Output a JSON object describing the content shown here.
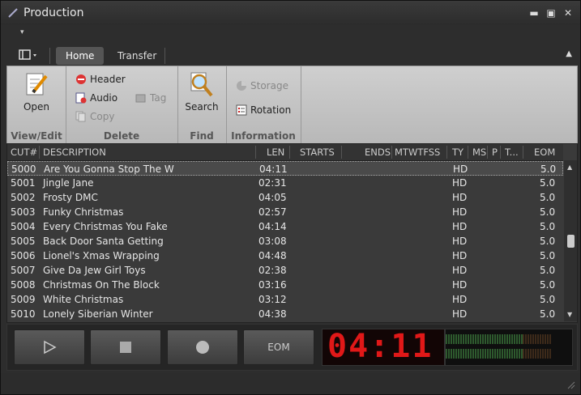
{
  "window": {
    "title": "Production"
  },
  "qat": {
    "icon": "dropdown-arrow"
  },
  "tabs": [
    {
      "label": "Home",
      "active": true
    },
    {
      "label": "Transfer",
      "active": false
    }
  ],
  "ribbon": {
    "view_edit": {
      "label": "View/Edit",
      "open": "Open"
    },
    "delete": {
      "label": "Delete",
      "header": "Header",
      "audio": "Audio",
      "tag": "Tag",
      "copy": "Copy"
    },
    "find": {
      "label": "Find",
      "search": "Search"
    },
    "information": {
      "label": "Information",
      "storage": "Storage",
      "rotation": "Rotation"
    }
  },
  "table": {
    "columns": [
      "CUT#",
      "DESCRIPTION",
      "LEN",
      "STARTS",
      "ENDS",
      "MTWTFSS",
      "TY",
      "MS",
      "P",
      "T...",
      "EOM"
    ],
    "rows": [
      {
        "cut": "5000",
        "desc": "Are You Gonna Stop The W",
        "len": "04:11",
        "ty": "HD",
        "eom": "5.0",
        "selected": true
      },
      {
        "cut": "5001",
        "desc": "Jingle Jane",
        "len": "02:31",
        "ty": "HD",
        "eom": "5.0"
      },
      {
        "cut": "5002",
        "desc": "Frosty DMC",
        "len": "04:05",
        "ty": "HD",
        "eom": "5.0"
      },
      {
        "cut": "5003",
        "desc": "Funky Christmas",
        "len": "02:57",
        "ty": "HD",
        "eom": "5.0"
      },
      {
        "cut": "5004",
        "desc": "Every Christmas You Fake",
        "len": "04:14",
        "ty": "HD",
        "eom": "5.0"
      },
      {
        "cut": "5005",
        "desc": "Back Door Santa Getting",
        "len": "03:08",
        "ty": "HD",
        "eom": "5.0"
      },
      {
        "cut": "5006",
        "desc": "Lionel's Xmas Wrapping",
        "len": "04:48",
        "ty": "HD",
        "eom": "5.0"
      },
      {
        "cut": "5007",
        "desc": "Give Da Jew Girl Toys",
        "len": "02:38",
        "ty": "HD",
        "eom": "5.0"
      },
      {
        "cut": "5008",
        "desc": "Christmas On The Block",
        "len": "03:16",
        "ty": "HD",
        "eom": "5.0"
      },
      {
        "cut": "5009",
        "desc": "White Christmas",
        "len": "03:12",
        "ty": "HD",
        "eom": "5.0"
      },
      {
        "cut": "5010",
        "desc": "Lonely Siberian Winter",
        "len": "04:38",
        "ty": "HD",
        "eom": "5.0"
      }
    ]
  },
  "controls": {
    "eom": "EOM",
    "timer": "04:11"
  },
  "colors": {
    "lcd_red": "#e01818",
    "meter_green": "#2e5a2e",
    "ribbon_bg": "#c4c4c4"
  }
}
